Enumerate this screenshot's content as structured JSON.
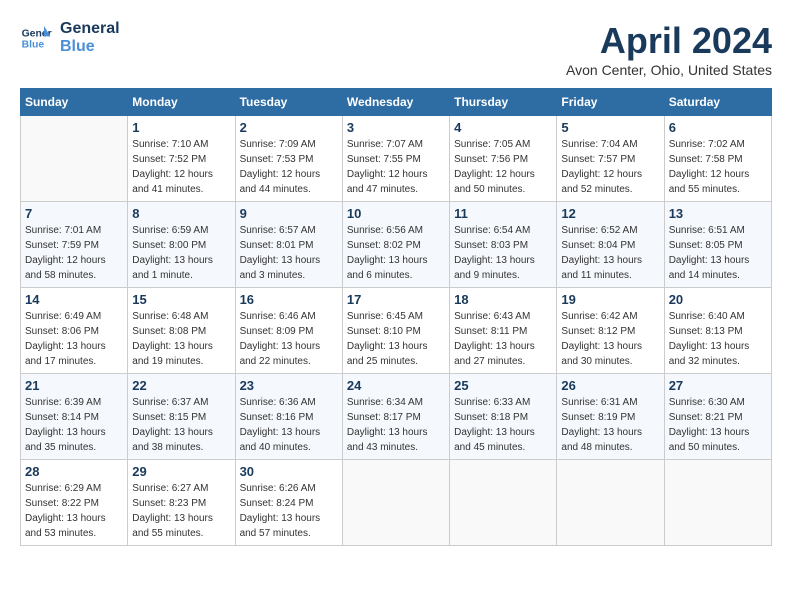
{
  "header": {
    "logo_line1": "General",
    "logo_line2": "Blue",
    "month_title": "April 2024",
    "subtitle": "Avon Center, Ohio, United States"
  },
  "days_of_week": [
    "Sunday",
    "Monday",
    "Tuesday",
    "Wednesday",
    "Thursday",
    "Friday",
    "Saturday"
  ],
  "weeks": [
    [
      {
        "day": "",
        "info": ""
      },
      {
        "day": "1",
        "info": "Sunrise: 7:10 AM\nSunset: 7:52 PM\nDaylight: 12 hours\nand 41 minutes."
      },
      {
        "day": "2",
        "info": "Sunrise: 7:09 AM\nSunset: 7:53 PM\nDaylight: 12 hours\nand 44 minutes."
      },
      {
        "day": "3",
        "info": "Sunrise: 7:07 AM\nSunset: 7:55 PM\nDaylight: 12 hours\nand 47 minutes."
      },
      {
        "day": "4",
        "info": "Sunrise: 7:05 AM\nSunset: 7:56 PM\nDaylight: 12 hours\nand 50 minutes."
      },
      {
        "day": "5",
        "info": "Sunrise: 7:04 AM\nSunset: 7:57 PM\nDaylight: 12 hours\nand 52 minutes."
      },
      {
        "day": "6",
        "info": "Sunrise: 7:02 AM\nSunset: 7:58 PM\nDaylight: 12 hours\nand 55 minutes."
      }
    ],
    [
      {
        "day": "7",
        "info": "Sunrise: 7:01 AM\nSunset: 7:59 PM\nDaylight: 12 hours\nand 58 minutes."
      },
      {
        "day": "8",
        "info": "Sunrise: 6:59 AM\nSunset: 8:00 PM\nDaylight: 13 hours\nand 1 minute."
      },
      {
        "day": "9",
        "info": "Sunrise: 6:57 AM\nSunset: 8:01 PM\nDaylight: 13 hours\nand 3 minutes."
      },
      {
        "day": "10",
        "info": "Sunrise: 6:56 AM\nSunset: 8:02 PM\nDaylight: 13 hours\nand 6 minutes."
      },
      {
        "day": "11",
        "info": "Sunrise: 6:54 AM\nSunset: 8:03 PM\nDaylight: 13 hours\nand 9 minutes."
      },
      {
        "day": "12",
        "info": "Sunrise: 6:52 AM\nSunset: 8:04 PM\nDaylight: 13 hours\nand 11 minutes."
      },
      {
        "day": "13",
        "info": "Sunrise: 6:51 AM\nSunset: 8:05 PM\nDaylight: 13 hours\nand 14 minutes."
      }
    ],
    [
      {
        "day": "14",
        "info": "Sunrise: 6:49 AM\nSunset: 8:06 PM\nDaylight: 13 hours\nand 17 minutes."
      },
      {
        "day": "15",
        "info": "Sunrise: 6:48 AM\nSunset: 8:08 PM\nDaylight: 13 hours\nand 19 minutes."
      },
      {
        "day": "16",
        "info": "Sunrise: 6:46 AM\nSunset: 8:09 PM\nDaylight: 13 hours\nand 22 minutes."
      },
      {
        "day": "17",
        "info": "Sunrise: 6:45 AM\nSunset: 8:10 PM\nDaylight: 13 hours\nand 25 minutes."
      },
      {
        "day": "18",
        "info": "Sunrise: 6:43 AM\nSunset: 8:11 PM\nDaylight: 13 hours\nand 27 minutes."
      },
      {
        "day": "19",
        "info": "Sunrise: 6:42 AM\nSunset: 8:12 PM\nDaylight: 13 hours\nand 30 minutes."
      },
      {
        "day": "20",
        "info": "Sunrise: 6:40 AM\nSunset: 8:13 PM\nDaylight: 13 hours\nand 32 minutes."
      }
    ],
    [
      {
        "day": "21",
        "info": "Sunrise: 6:39 AM\nSunset: 8:14 PM\nDaylight: 13 hours\nand 35 minutes."
      },
      {
        "day": "22",
        "info": "Sunrise: 6:37 AM\nSunset: 8:15 PM\nDaylight: 13 hours\nand 38 minutes."
      },
      {
        "day": "23",
        "info": "Sunrise: 6:36 AM\nSunset: 8:16 PM\nDaylight: 13 hours\nand 40 minutes."
      },
      {
        "day": "24",
        "info": "Sunrise: 6:34 AM\nSunset: 8:17 PM\nDaylight: 13 hours\nand 43 minutes."
      },
      {
        "day": "25",
        "info": "Sunrise: 6:33 AM\nSunset: 8:18 PM\nDaylight: 13 hours\nand 45 minutes."
      },
      {
        "day": "26",
        "info": "Sunrise: 6:31 AM\nSunset: 8:19 PM\nDaylight: 13 hours\nand 48 minutes."
      },
      {
        "day": "27",
        "info": "Sunrise: 6:30 AM\nSunset: 8:21 PM\nDaylight: 13 hours\nand 50 minutes."
      }
    ],
    [
      {
        "day": "28",
        "info": "Sunrise: 6:29 AM\nSunset: 8:22 PM\nDaylight: 13 hours\nand 53 minutes."
      },
      {
        "day": "29",
        "info": "Sunrise: 6:27 AM\nSunset: 8:23 PM\nDaylight: 13 hours\nand 55 minutes."
      },
      {
        "day": "30",
        "info": "Sunrise: 6:26 AM\nSunset: 8:24 PM\nDaylight: 13 hours\nand 57 minutes."
      },
      {
        "day": "",
        "info": ""
      },
      {
        "day": "",
        "info": ""
      },
      {
        "day": "",
        "info": ""
      },
      {
        "day": "",
        "info": ""
      }
    ]
  ]
}
